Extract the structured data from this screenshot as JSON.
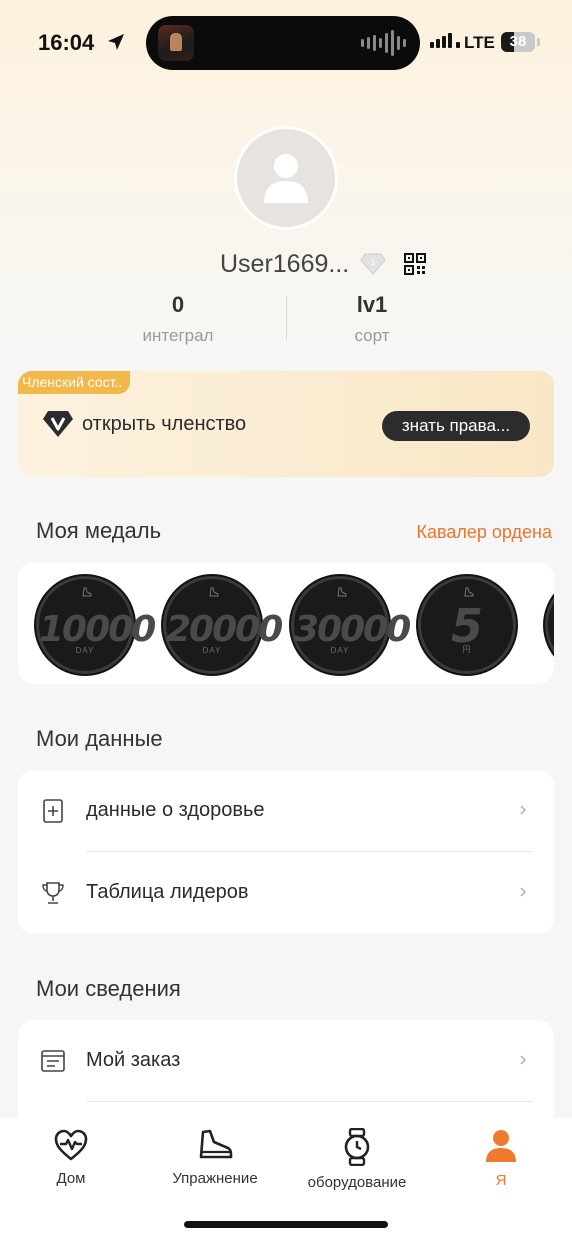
{
  "status_bar": {
    "time": "16:04",
    "network": "LTE",
    "battery": "38",
    "battery_level_percent": 38
  },
  "profile": {
    "username": "User1669...",
    "stats": [
      {
        "value": "0",
        "label": "интеграл"
      },
      {
        "value": "lv1",
        "label": "сорт"
      }
    ]
  },
  "membership": {
    "tag": "Членский сост..",
    "text": "открыть членство",
    "button": "знать права..."
  },
  "medals_section": {
    "title": "Моя медаль",
    "link": "Кавалер ордена",
    "medals": [
      {
        "value": "10000",
        "unit": "DAY"
      },
      {
        "value": "20000",
        "unit": "DAY"
      },
      {
        "value": "30000",
        "unit": "DAY"
      },
      {
        "value": "5",
        "unit": "円"
      }
    ]
  },
  "data_section": {
    "title": "Мои данные",
    "items": [
      {
        "label": "данные о здоровье",
        "icon": "health-data-icon"
      },
      {
        "label": "Таблица лидеров",
        "icon": "trophy-icon"
      }
    ]
  },
  "info_section": {
    "title": "Мои сведения",
    "items": [
      {
        "label": "Мой заказ",
        "icon": "order-list-icon"
      }
    ]
  },
  "tab_bar": {
    "tabs": [
      {
        "label": "Дом",
        "icon": "heart-pulse-icon"
      },
      {
        "label": "Упражнение",
        "icon": "shoe-icon"
      },
      {
        "label": "оборудование",
        "icon": "watch-icon"
      },
      {
        "label": "Я",
        "icon": "person-icon"
      }
    ],
    "active_tab": "Я"
  },
  "colors": {
    "accent": "#ef7a2e",
    "member_tag": "#f2b84b",
    "dark_button": "#2c2c2c"
  }
}
